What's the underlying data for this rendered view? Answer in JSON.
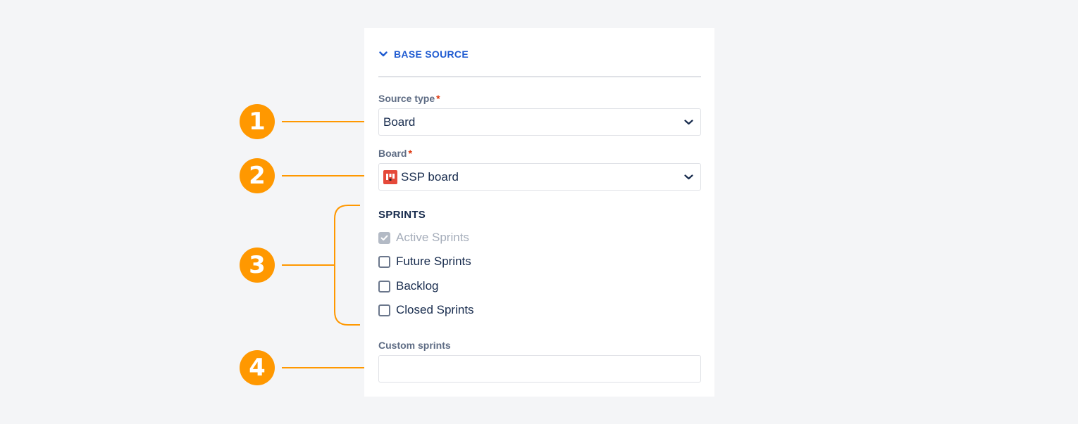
{
  "section": {
    "title": "BASE SOURCE",
    "icon": "chevron-down-icon"
  },
  "source_type": {
    "label": "Source type",
    "required_mark": "*",
    "value": "Board"
  },
  "board": {
    "label": "Board",
    "required_mark": "*",
    "value": "SSP board",
    "icon": "board-icon"
  },
  "sprints": {
    "title": "SPRINTS",
    "options": [
      {
        "label": "Active Sprints",
        "checked": true,
        "disabled": true
      },
      {
        "label": "Future Sprints",
        "checked": false,
        "disabled": false
      },
      {
        "label": "Backlog",
        "checked": false,
        "disabled": false
      },
      {
        "label": "Closed Sprints",
        "checked": false,
        "disabled": false
      }
    ]
  },
  "custom_sprints": {
    "label": "Custom sprints",
    "value": ""
  },
  "callouts": [
    "1",
    "2",
    "3",
    "4"
  ],
  "colors": {
    "accent": "#ff9800",
    "link": "#1f5bd1",
    "required": "#de350b"
  }
}
